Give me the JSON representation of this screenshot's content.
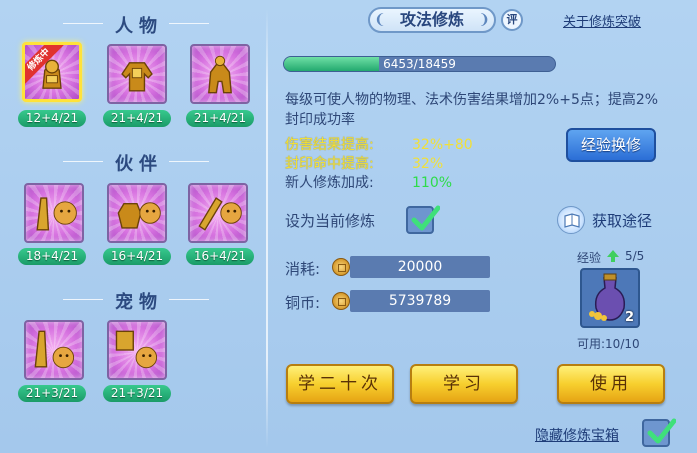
{
  "left": {
    "sections": {
      "character": "人物",
      "partner": "伙伴",
      "pet": "宠物"
    },
    "slots": {
      "char_1": {
        "level": "12+4/21",
        "tag": "修炼中"
      },
      "char_2": {
        "level": "21+4/21"
      },
      "char_3": {
        "level": "21+4/21"
      },
      "partner_1": {
        "level": "18+4/21"
      },
      "partner_2": {
        "level": "16+4/21"
      },
      "partner_3": {
        "level": "16+4/21"
      },
      "pet_1": {
        "level": "21+3/21"
      },
      "pet_2": {
        "level": "21+3/21"
      }
    }
  },
  "header": {
    "title": "攻法修炼",
    "eval": "评",
    "link": "关于修炼突破"
  },
  "progress": {
    "text": "6453/18459",
    "fraction": 0.3496
  },
  "description": "每级可使人物的物理、法术伤害结果增加2%+5点；提高2%封印成功率",
  "stats": {
    "damage_label": "伤害结果提高:",
    "damage_value": "32%+80",
    "seal_label": "封印命中提高:",
    "seal_value": "32%",
    "novice_label": "新人修炼加成:",
    "novice_value": "110%"
  },
  "buttons": {
    "exchange": "经验换修",
    "learn20": "学二十次",
    "learn": "学习",
    "use": "使用"
  },
  "set_current": "设为当前修炼",
  "obtain": "获取途径",
  "cost": {
    "consume_label": "消耗:",
    "consume_value": "20000",
    "copper_label": "铜币:",
    "copper_value": "5739789"
  },
  "item": {
    "exp_label": "经验",
    "exp_value": "5/5",
    "count": "2",
    "usable": "可用:10/10"
  },
  "hide_treasure": "隐藏修炼宝箱",
  "colors": {
    "highlight": "#f1e03a",
    "bonus": "#2ddc4a",
    "level_badge": "#1b9b68",
    "selected_border": "#ffe23a"
  }
}
